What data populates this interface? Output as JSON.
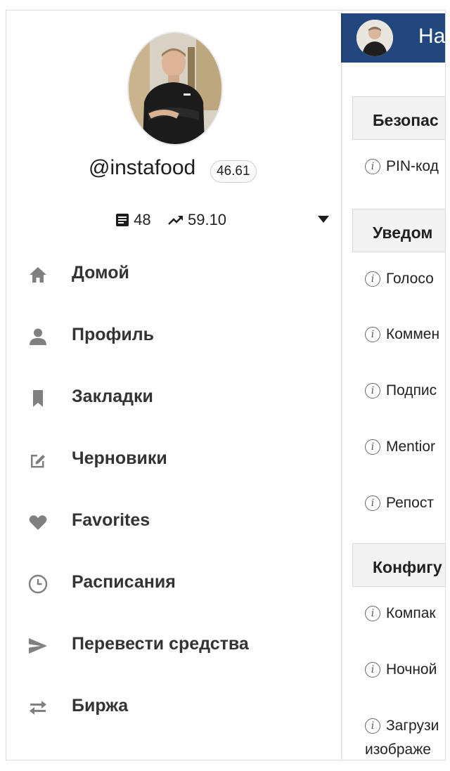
{
  "settings": {
    "header_title": "На",
    "sections": [
      {
        "heading": "Безопас",
        "rows": [
          "PIN-код"
        ]
      },
      {
        "heading": "Уведом",
        "rows": [
          "Голосо",
          "Коммен",
          "Подпис",
          "Mentior",
          "Репост"
        ]
      },
      {
        "heading": "Конфигу",
        "rows": [
          "Компак",
          "Ночной",
          "Загрузи"
        ]
      }
    ],
    "last_row_line2": "изображе"
  },
  "drawer": {
    "username": "@instafood",
    "reputation": "46.61",
    "posts_count": "48",
    "trend_value": "59.10",
    "menu": [
      {
        "label": "Домой",
        "icon": "home-icon"
      },
      {
        "label": "Профиль",
        "icon": "person-icon"
      },
      {
        "label": "Закладки",
        "icon": "bookmark-icon"
      },
      {
        "label": "Черновики",
        "icon": "edit-icon"
      },
      {
        "label": "Favorites",
        "icon": "heart-icon"
      },
      {
        "label": "Расписания",
        "icon": "clock-icon"
      },
      {
        "label": "Перевести средства",
        "icon": "send-icon"
      },
      {
        "label": "Биржа",
        "icon": "swap-icon"
      }
    ]
  },
  "colors": {
    "header_bg": "#21477e",
    "icon_gray": "#808080",
    "text": "#333333"
  }
}
